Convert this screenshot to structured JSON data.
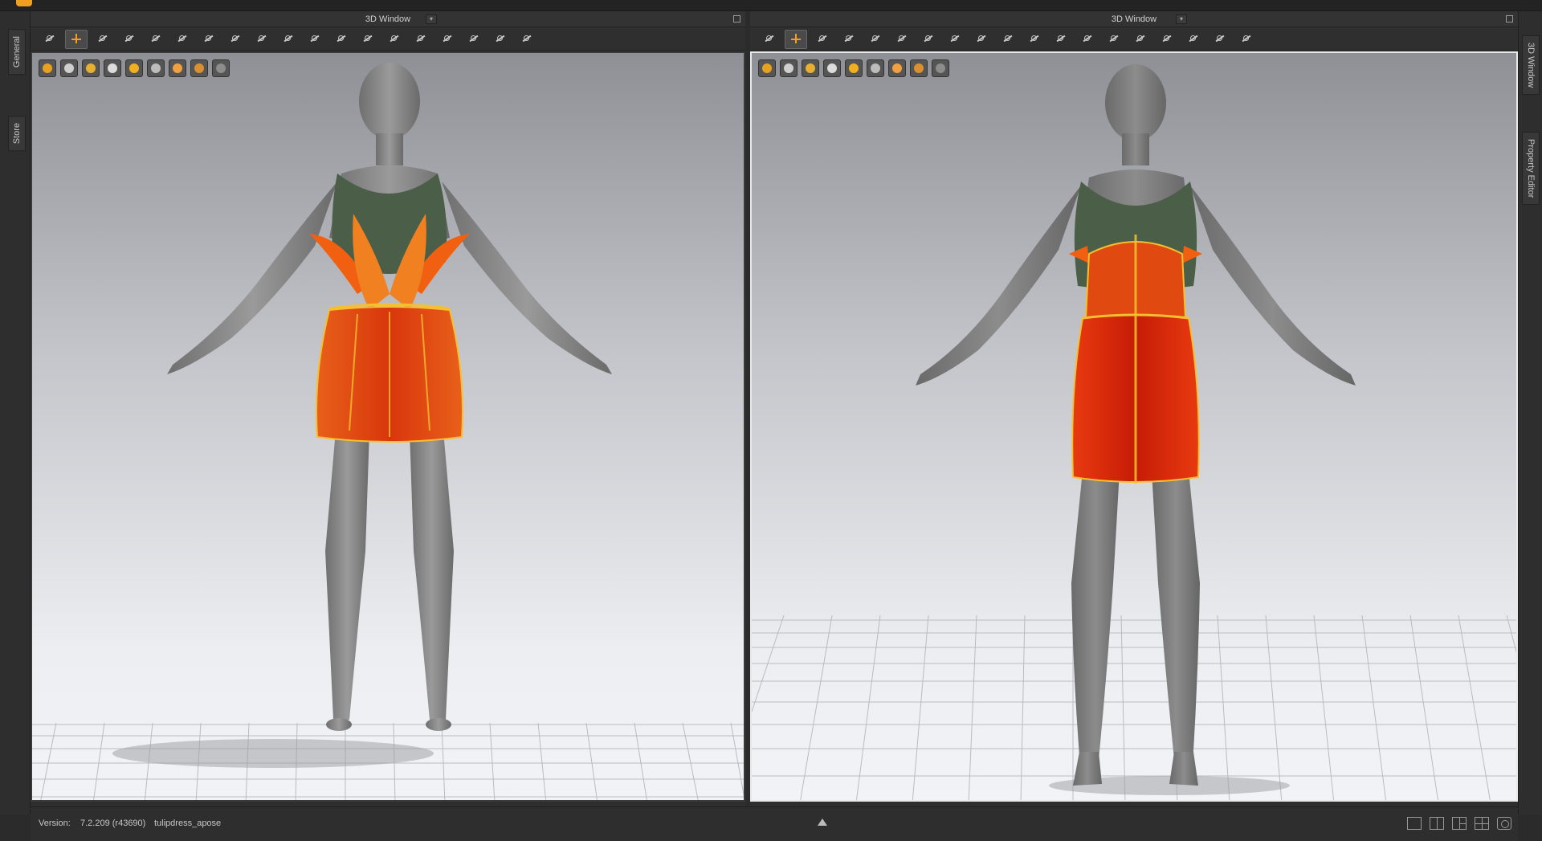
{
  "viewports": {
    "left": {
      "title": "3D Window"
    },
    "right": {
      "title": "3D Window"
    }
  },
  "left_tabs": {
    "general": "General",
    "store": "Store"
  },
  "right_tabs": {
    "window": "3D Window",
    "property_editor": "Property Editor"
  },
  "toolbar": {
    "tool_icons": [
      "select-icon",
      "move-icon",
      "transform-pattern-icon",
      "transform-outfit-icon",
      "edit-curvature-icon",
      "fold-arrangement-icon",
      "arrangement-icon",
      "tack-icon",
      "pin-icon",
      "grid-icon",
      "strap-icon",
      "puckering-icon",
      "button-icon",
      "zipper-icon",
      "elastic-icon",
      "shrink-icon",
      "split-icon",
      "measure-icon",
      "pose-icon"
    ],
    "active_tool": "move-icon"
  },
  "display_toolbar": {
    "icons": [
      "avatar-display-icon",
      "garment-display-icon",
      "texture-display-icon",
      "stress-map-icon",
      "fitting-map-icon",
      "shadow-icon",
      "skin-icon",
      "hair-icon",
      "floor-icon"
    ]
  },
  "status_bar": {
    "version_label": "Version:",
    "version_value": "7.2.209 (r43690)",
    "scene_name": "tulipdress_apose"
  },
  "layout_icons": [
    "single-view-icon",
    "dual-view-icon",
    "triple-view-icon",
    "quad-view-icon",
    "settings-view-icon"
  ],
  "colors": {
    "accent": "#f0a020",
    "dress_red": "#d82a08",
    "dress_orange": "#f05a10",
    "bodice_green": "#4a5e48",
    "avatar_gray": "#8a8a8a"
  }
}
